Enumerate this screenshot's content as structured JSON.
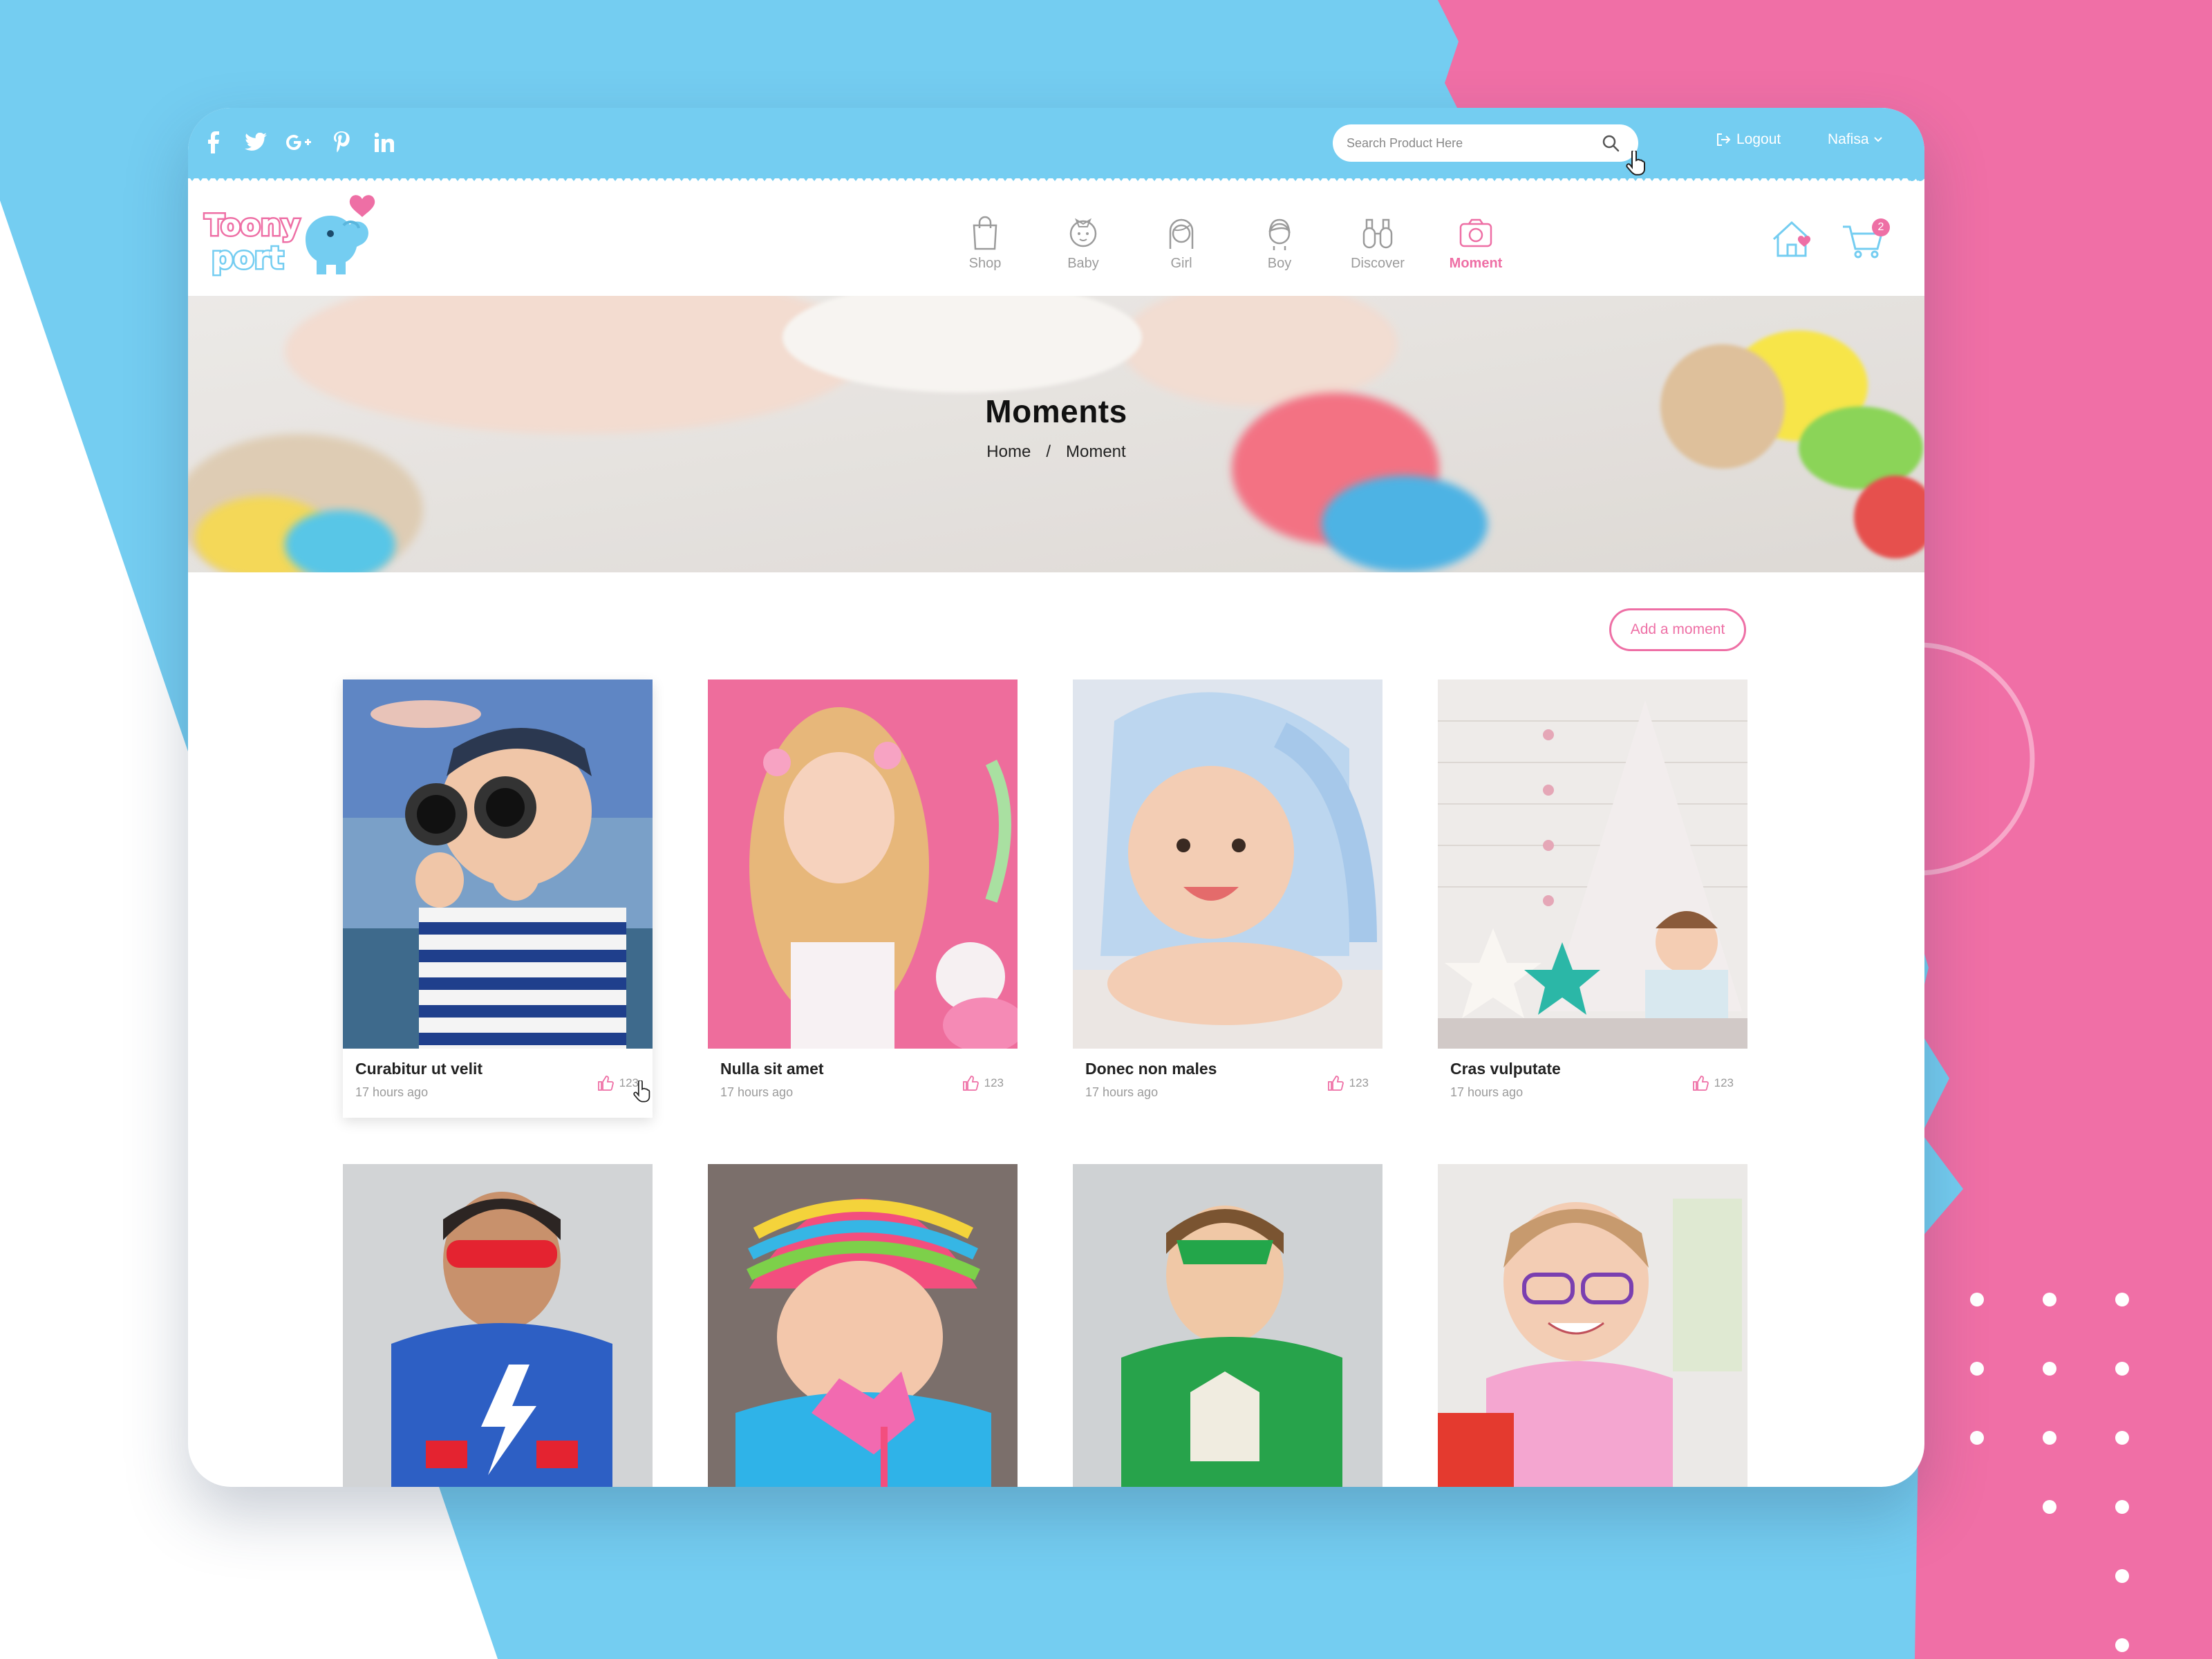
{
  "colors": {
    "primary_blue": "#74cdf1",
    "accent_pink": "#ee6fa5",
    "background_pink": "#f06fa6"
  },
  "social": [
    {
      "name": "facebook-icon"
    },
    {
      "name": "twitter-icon"
    },
    {
      "name": "google-plus-icon"
    },
    {
      "name": "pinterest-icon"
    },
    {
      "name": "linkedin-icon"
    }
  ],
  "search": {
    "placeholder": "Search Product Here"
  },
  "topbar": {
    "logout": "Logout",
    "user": "Nafisa"
  },
  "brand": {
    "line1": "Toony",
    "line2": "port"
  },
  "nav": {
    "items": [
      {
        "label": "Shop",
        "icon": "bag-icon"
      },
      {
        "label": "Baby",
        "icon": "baby-icon"
      },
      {
        "label": "Girl",
        "icon": "girl-icon"
      },
      {
        "label": "Boy",
        "icon": "boy-icon"
      },
      {
        "label": "Discover",
        "icon": "binoculars-icon"
      },
      {
        "label": "Moment",
        "icon": "camera-icon",
        "active": true
      }
    ],
    "cart_count": "2"
  },
  "hero": {
    "title": "Moments",
    "breadcrumb": {
      "home": "Home",
      "separator": "/",
      "current": "Moment"
    }
  },
  "actions": {
    "add_moment": "Add a moment"
  },
  "moments": [
    {
      "title": "Curabitur ut velit",
      "time": "17 hours ago",
      "likes": "123"
    },
    {
      "title": "Nulla sit amet",
      "time": "17 hours ago",
      "likes": "123"
    },
    {
      "title": "Donec non males",
      "time": "17 hours ago",
      "likes": "123"
    },
    {
      "title": "Cras vulputate",
      "time": "17 hours ago",
      "likes": "123"
    }
  ]
}
